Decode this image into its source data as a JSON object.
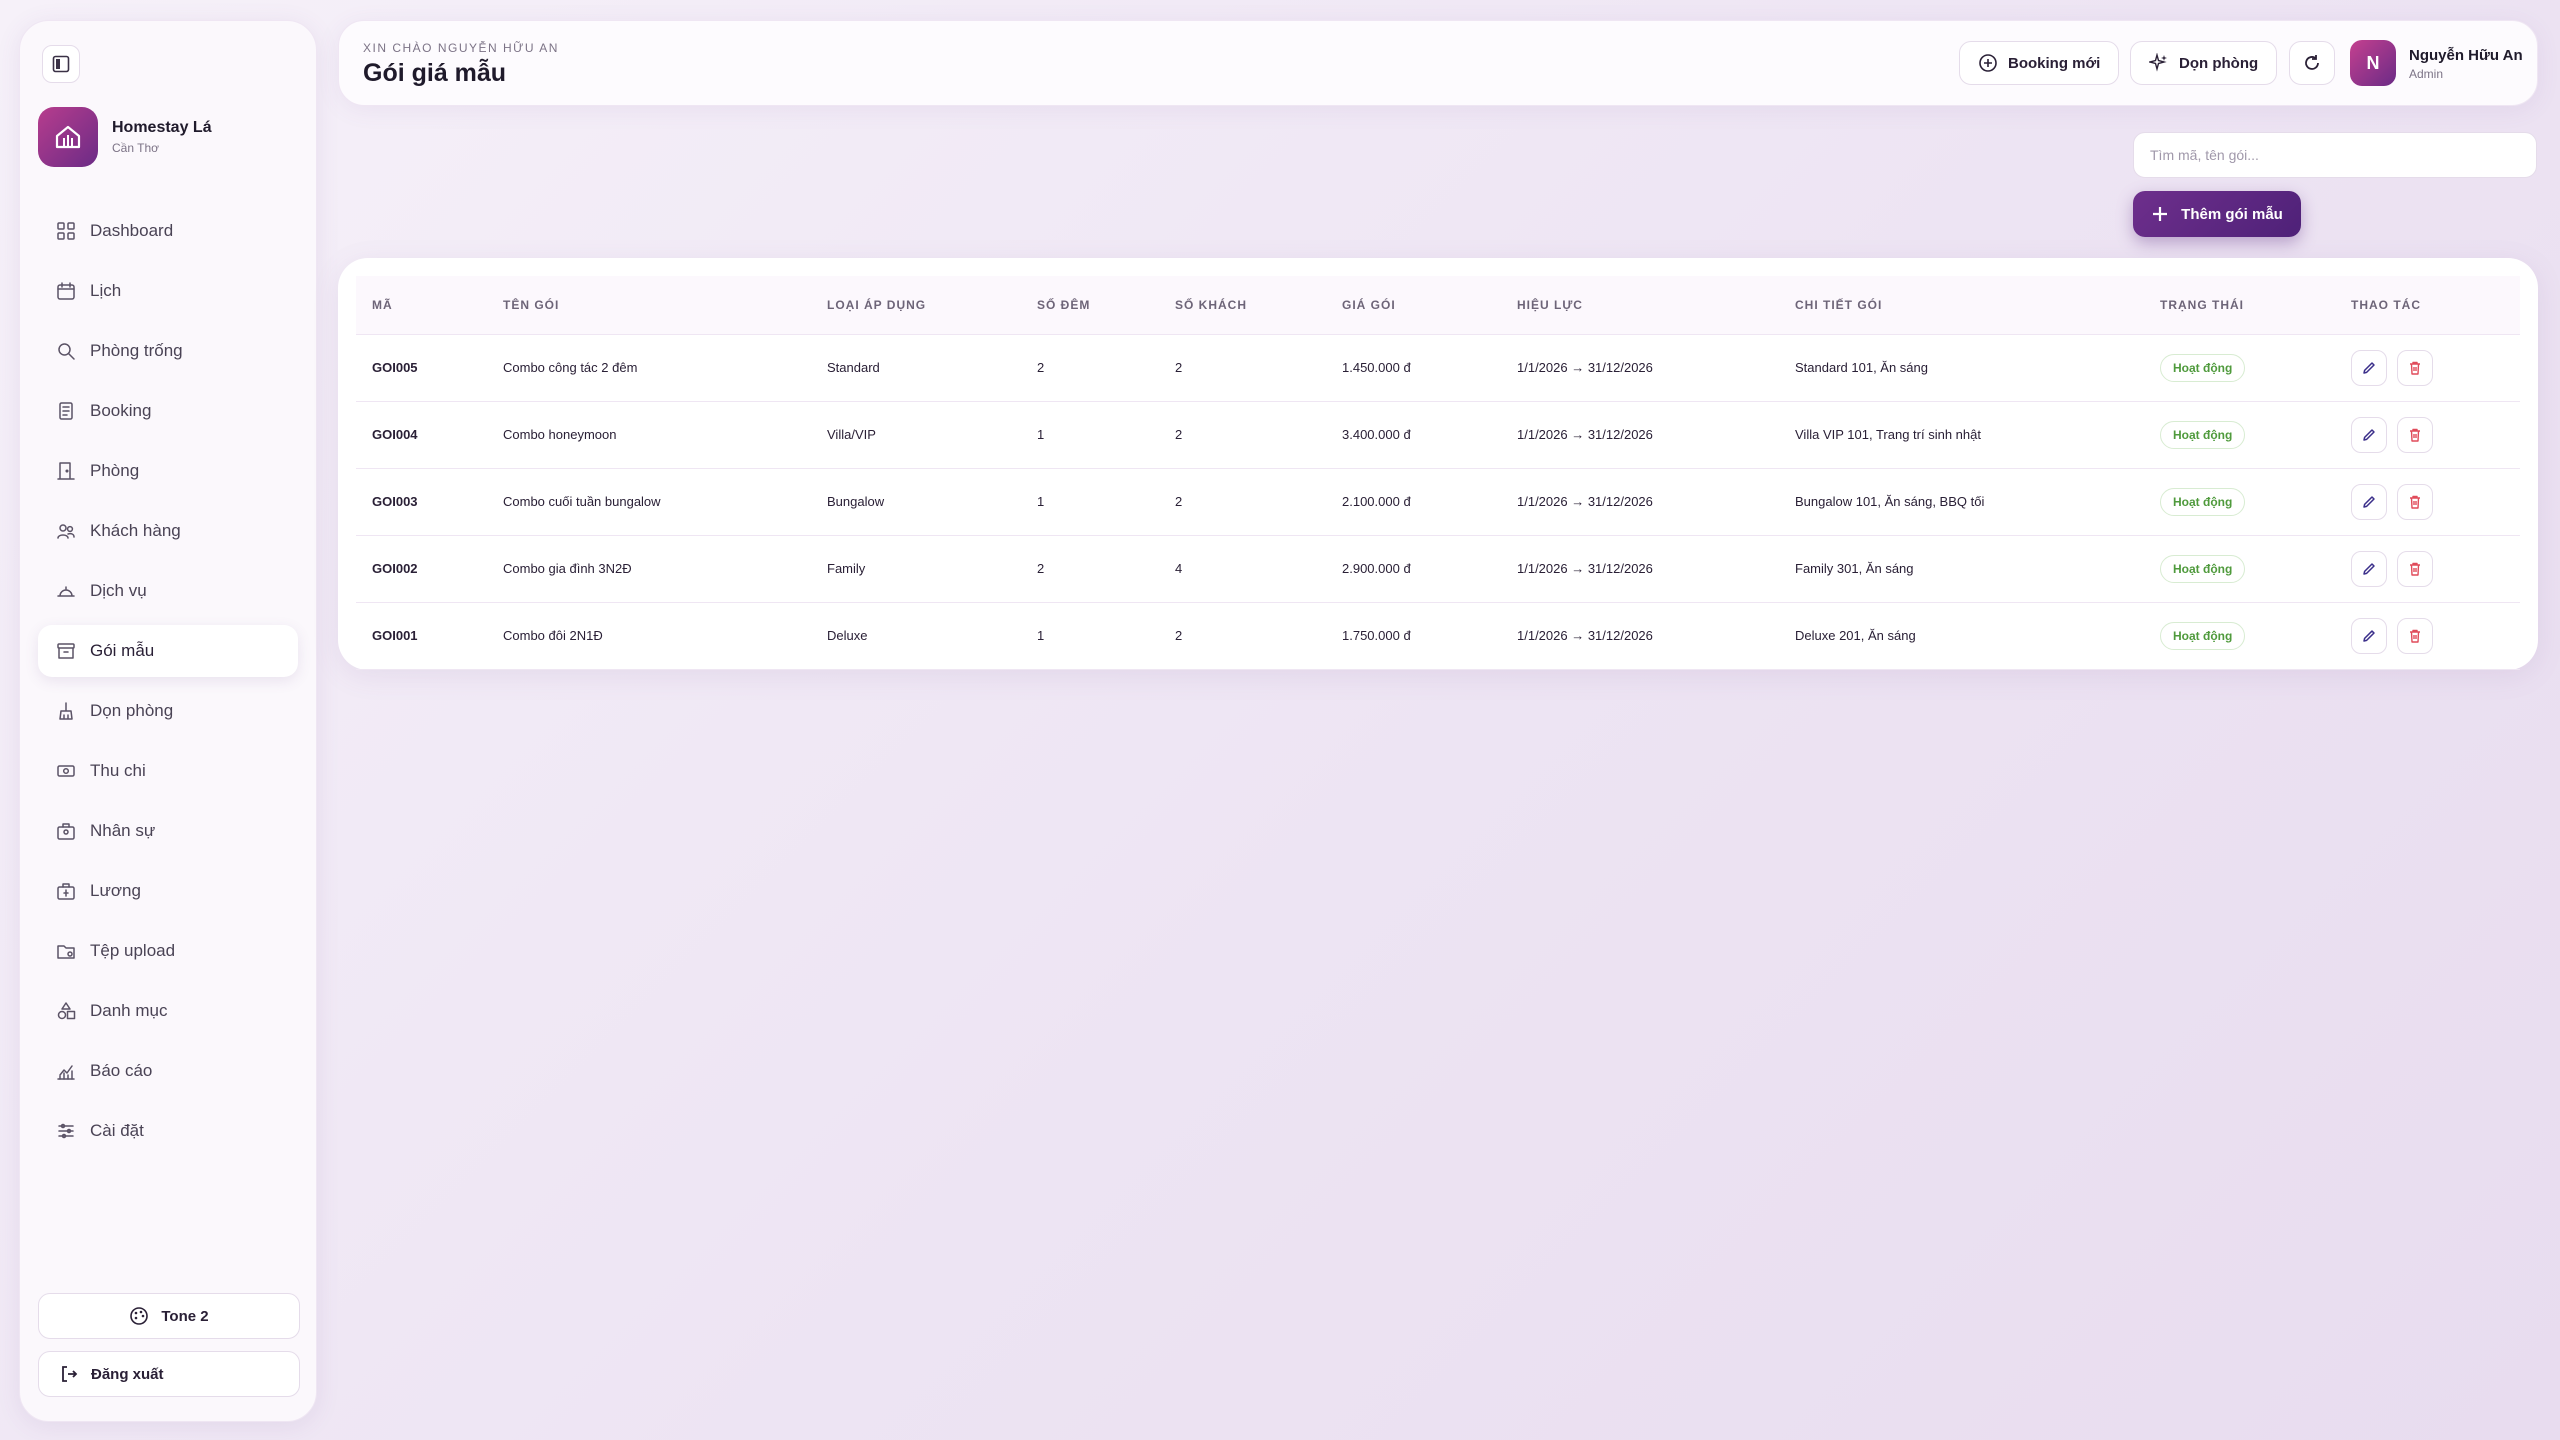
{
  "sidebar": {
    "brand": {
      "name": "Homestay Lá",
      "location": "Cần Thơ"
    },
    "items": [
      {
        "label": "Dashboard",
        "icon": "dashboard-icon"
      },
      {
        "label": "Lịch",
        "icon": "calendar-icon"
      },
      {
        "label": "Phòng trống",
        "icon": "search-icon"
      },
      {
        "label": "Booking",
        "icon": "booking-icon"
      },
      {
        "label": "Phòng",
        "icon": "door-icon"
      },
      {
        "label": "Khách hàng",
        "icon": "users-icon"
      },
      {
        "label": "Dịch vụ",
        "icon": "service-icon"
      },
      {
        "label": "Gói mẫu",
        "icon": "package-icon",
        "active": true
      },
      {
        "label": "Dọn phòng",
        "icon": "broom-icon"
      },
      {
        "label": "Thu chi",
        "icon": "money-icon"
      },
      {
        "label": "Nhân sự",
        "icon": "staff-icon"
      },
      {
        "label": "Lương",
        "icon": "salary-icon"
      },
      {
        "label": "Tệp upload",
        "icon": "folder-icon"
      },
      {
        "label": "Danh mục",
        "icon": "category-icon"
      },
      {
        "label": "Báo cáo",
        "icon": "report-icon"
      },
      {
        "label": "Cài đặt",
        "icon": "settings-icon"
      }
    ],
    "tone_label": "Tone 2",
    "logout_label": "Đăng xuất"
  },
  "header": {
    "greeting": "XIN CHÀO NGUYỄN HỮU AN",
    "title": "Gói giá mẫu",
    "booking_label": "Booking mới",
    "clean_label": "Dọn phòng",
    "user": {
      "initial": "N",
      "name": "Nguyễn Hữu An",
      "role": "Admin"
    }
  },
  "search": {
    "placeholder": "Tìm mã, tên gói..."
  },
  "add_label": "Thêm gói mẫu",
  "table": {
    "columns": [
      "MÃ",
      "TÊN GÓI",
      "LOẠI ÁP DỤNG",
      "SỐ ĐÊM",
      "SỐ KHÁCH",
      "GIÁ GÓI",
      "HIỆU LỰC",
      "CHI TIẾT GÓI",
      "TRẠNG THÁI",
      "THAO TÁC"
    ],
    "rows": [
      {
        "code": "GOI005",
        "name": "Combo công tác 2 đêm",
        "type": "Standard",
        "nights": "2",
        "guests": "2",
        "price": "1.450.000 đ",
        "valid": "1/1/2026 → 31/12/2026",
        "details": "Standard 101, Ăn sáng",
        "status": "Hoạt động"
      },
      {
        "code": "GOI004",
        "name": "Combo honeymoon",
        "type": "Villa/VIP",
        "nights": "1",
        "guests": "2",
        "price": "3.400.000 đ",
        "valid": "1/1/2026 → 31/12/2026",
        "details": "Villa VIP 101, Trang trí sinh nhật",
        "status": "Hoạt động"
      },
      {
        "code": "GOI003",
        "name": "Combo cuối tuần bungalow",
        "type": "Bungalow",
        "nights": "1",
        "guests": "2",
        "price": "2.100.000 đ",
        "valid": "1/1/2026 → 31/12/2026",
        "details": "Bungalow 101, Ăn sáng, BBQ tối",
        "status": "Hoạt động"
      },
      {
        "code": "GOI002",
        "name": "Combo gia đình 3N2Đ",
        "type": "Family",
        "nights": "2",
        "guests": "4",
        "price": "2.900.000 đ",
        "valid": "1/1/2026 → 31/12/2026",
        "details": "Family 301, Ăn sáng",
        "status": "Hoạt động"
      },
      {
        "code": "GOI001",
        "name": "Combo đôi 2N1Đ",
        "type": "Deluxe",
        "nights": "1",
        "guests": "2",
        "price": "1.750.000 đ",
        "valid": "1/1/2026 → 31/12/2026",
        "details": "Deluxe 201, Ăn sáng",
        "status": "Hoạt động"
      }
    ]
  },
  "colors": {
    "accent": "#5a2580",
    "brand_gradient_start": "#b73d8d",
    "status_active": "#4f9a3c",
    "delete": "#e04b5a"
  }
}
